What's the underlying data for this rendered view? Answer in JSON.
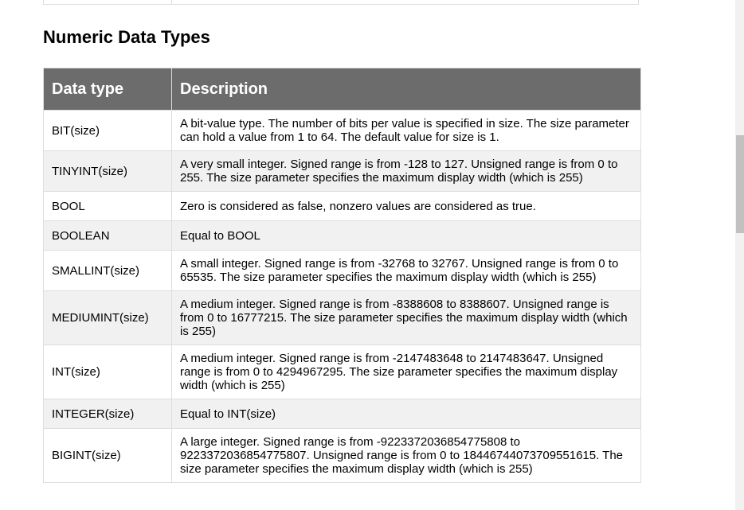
{
  "section": {
    "title": "Numeric Data Types"
  },
  "table": {
    "headers": {
      "data_type": "Data type",
      "description": "Description"
    },
    "rows": [
      {
        "type": "BIT(size)",
        "description": "A bit-value type. The number of bits per value is specified in size. The size parameter can hold a value from 1 to 64. The default value for size is 1."
      },
      {
        "type": "TINYINT(size)",
        "description": "A very small integer. Signed range is from -128 to 127. Unsigned range is from 0 to 255. The size parameter specifies the maximum display width (which is 255)"
      },
      {
        "type": "BOOL",
        "description": "Zero is considered as false, nonzero values are considered as true."
      },
      {
        "type": "BOOLEAN",
        "description": "Equal to BOOL"
      },
      {
        "type": "SMALLINT(size)",
        "description": "A small integer. Signed range is from -32768 to 32767. Unsigned range is from 0 to 65535. The size parameter specifies the maximum display width (which is 255)"
      },
      {
        "type": "MEDIUMINT(size)",
        "description": "A medium integer. Signed range is from -8388608 to 8388607. Unsigned range is from 0 to 16777215. The size parameter specifies the maximum display width (which is 255)"
      },
      {
        "type": "INT(size)",
        "description": "A medium integer. Signed range is from -2147483648 to 2147483647. Unsigned range is from 0 to 4294967295. The size parameter specifies the maximum display width (which is 255)"
      },
      {
        "type": "INTEGER(size)",
        "description": "Equal to INT(size)"
      },
      {
        "type": "BIGINT(size)",
        "description": "A large integer. Signed range is from -9223372036854775808 to 9223372036854775807. Unsigned range is from 0 to 18446744073709551615. The size parameter specifies the maximum display width (which is 255)"
      }
    ]
  }
}
